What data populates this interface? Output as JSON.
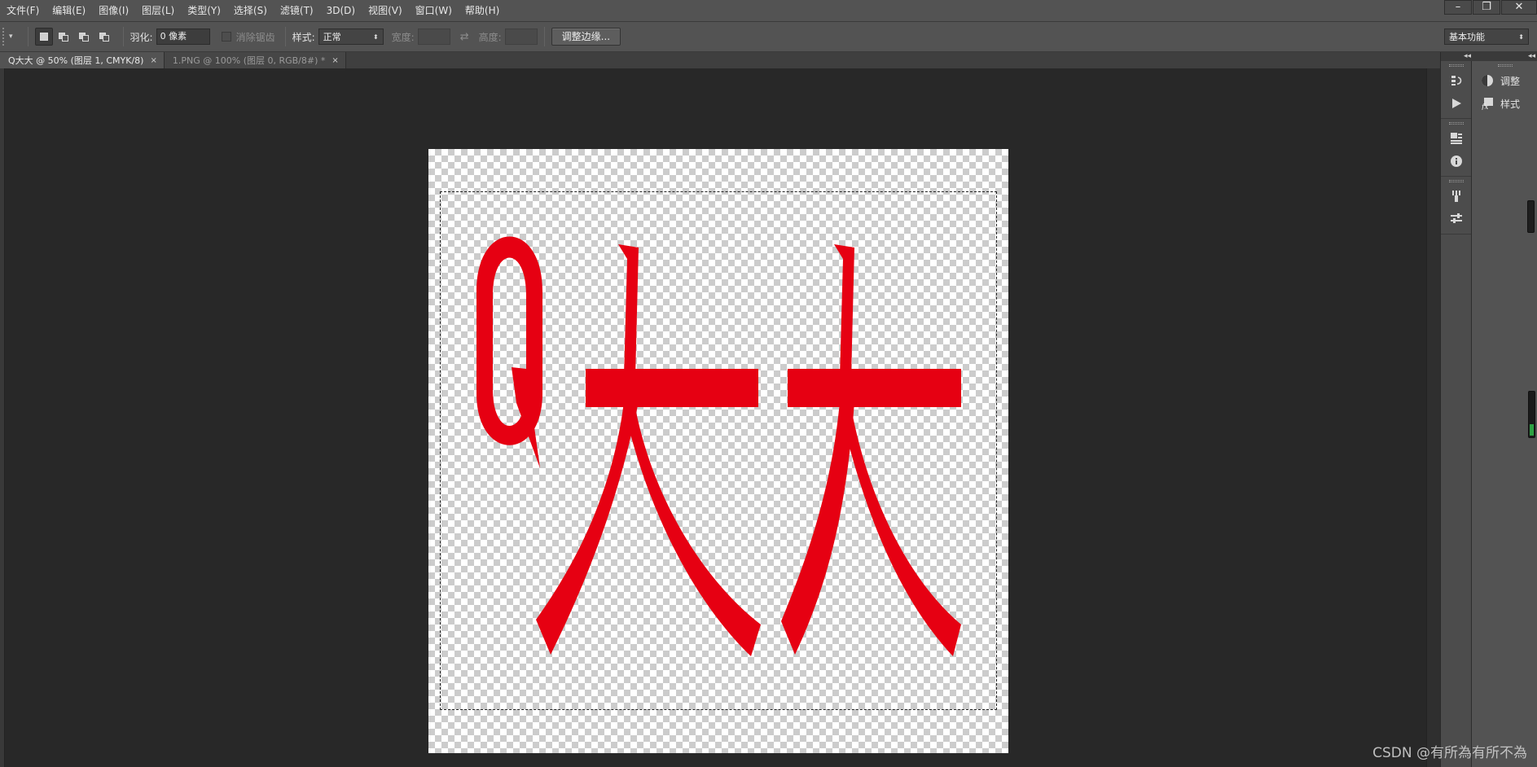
{
  "menu": {
    "items": [
      "文件(F)",
      "编辑(E)",
      "图像(I)",
      "图层(L)",
      "类型(Y)",
      "选择(S)",
      "滤镜(T)",
      "3D(D)",
      "视图(V)",
      "窗口(W)",
      "帮助(H)"
    ]
  },
  "window_controls": {
    "minimize": "–",
    "restore": "❐",
    "close": "✕"
  },
  "options_bar": {
    "feather_label": "羽化:",
    "feather_value": "0 像素",
    "antialias_label": "消除锯齿",
    "style_label": "样式:",
    "style_value": "正常",
    "width_label": "宽度:",
    "height_label": "高度:",
    "refine_edge_button": "调整边缘...",
    "workspace_value": "基本功能"
  },
  "tabs": [
    {
      "label": "Q大大 @ 50% (图层 1, CMYK/8)",
      "close": "×",
      "active": true
    },
    {
      "label": "1.PNG @ 100% (图层 0, RGB/8#) *",
      "close": "×",
      "active": false
    }
  ],
  "canvas": {
    "text_content": "Q大大",
    "text_color": "#e60012"
  },
  "right_panel": {
    "collapse_glyph": "◂◂",
    "items": [
      {
        "label": "调整",
        "icon": "adjustments-icon"
      },
      {
        "label": "样式",
        "icon": "styles-icon"
      }
    ]
  },
  "watermark": "CSDN @有所為有所不為",
  "colors": {
    "chrome": "#535353",
    "workspace": "#282828",
    "accent_red": "#e60012"
  }
}
